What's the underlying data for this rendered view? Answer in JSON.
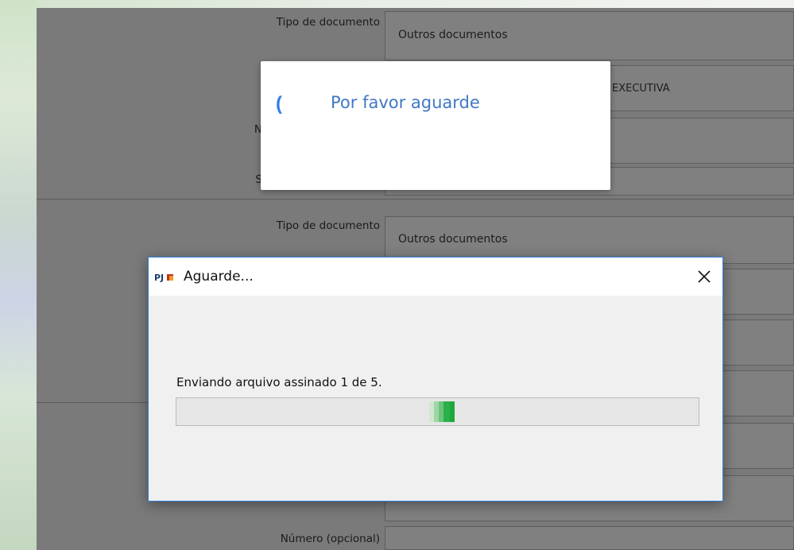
{
  "form": {
    "rows": [
      {
        "label": "Tipo de documento",
        "value": "Outros documentos"
      },
      {
        "label": "",
        "value": "EXECUTIVA"
      },
      {
        "label": "N",
        "value": ""
      },
      {
        "label": "S",
        "value": ""
      },
      {
        "label": "Tipo de documento",
        "value": "Outros documentos"
      },
      {
        "label": "Número (opcional)",
        "value": ""
      }
    ]
  },
  "loading_popup": {
    "message": "Por favor aguarde",
    "spinner_glyph": "("
  },
  "dialog": {
    "logo_text": "PJe",
    "title": "Aguarde...",
    "close_glyph": "✕",
    "status": "Enviando arquivo assinado 1 de 5.",
    "progress_indicator": "indeterminate"
  },
  "colors": {
    "overlay": "#7a7a7a",
    "accent_blue": "#2f7fd8",
    "loading_text": "#3f78c4",
    "progress_green": "#1ea83c"
  }
}
